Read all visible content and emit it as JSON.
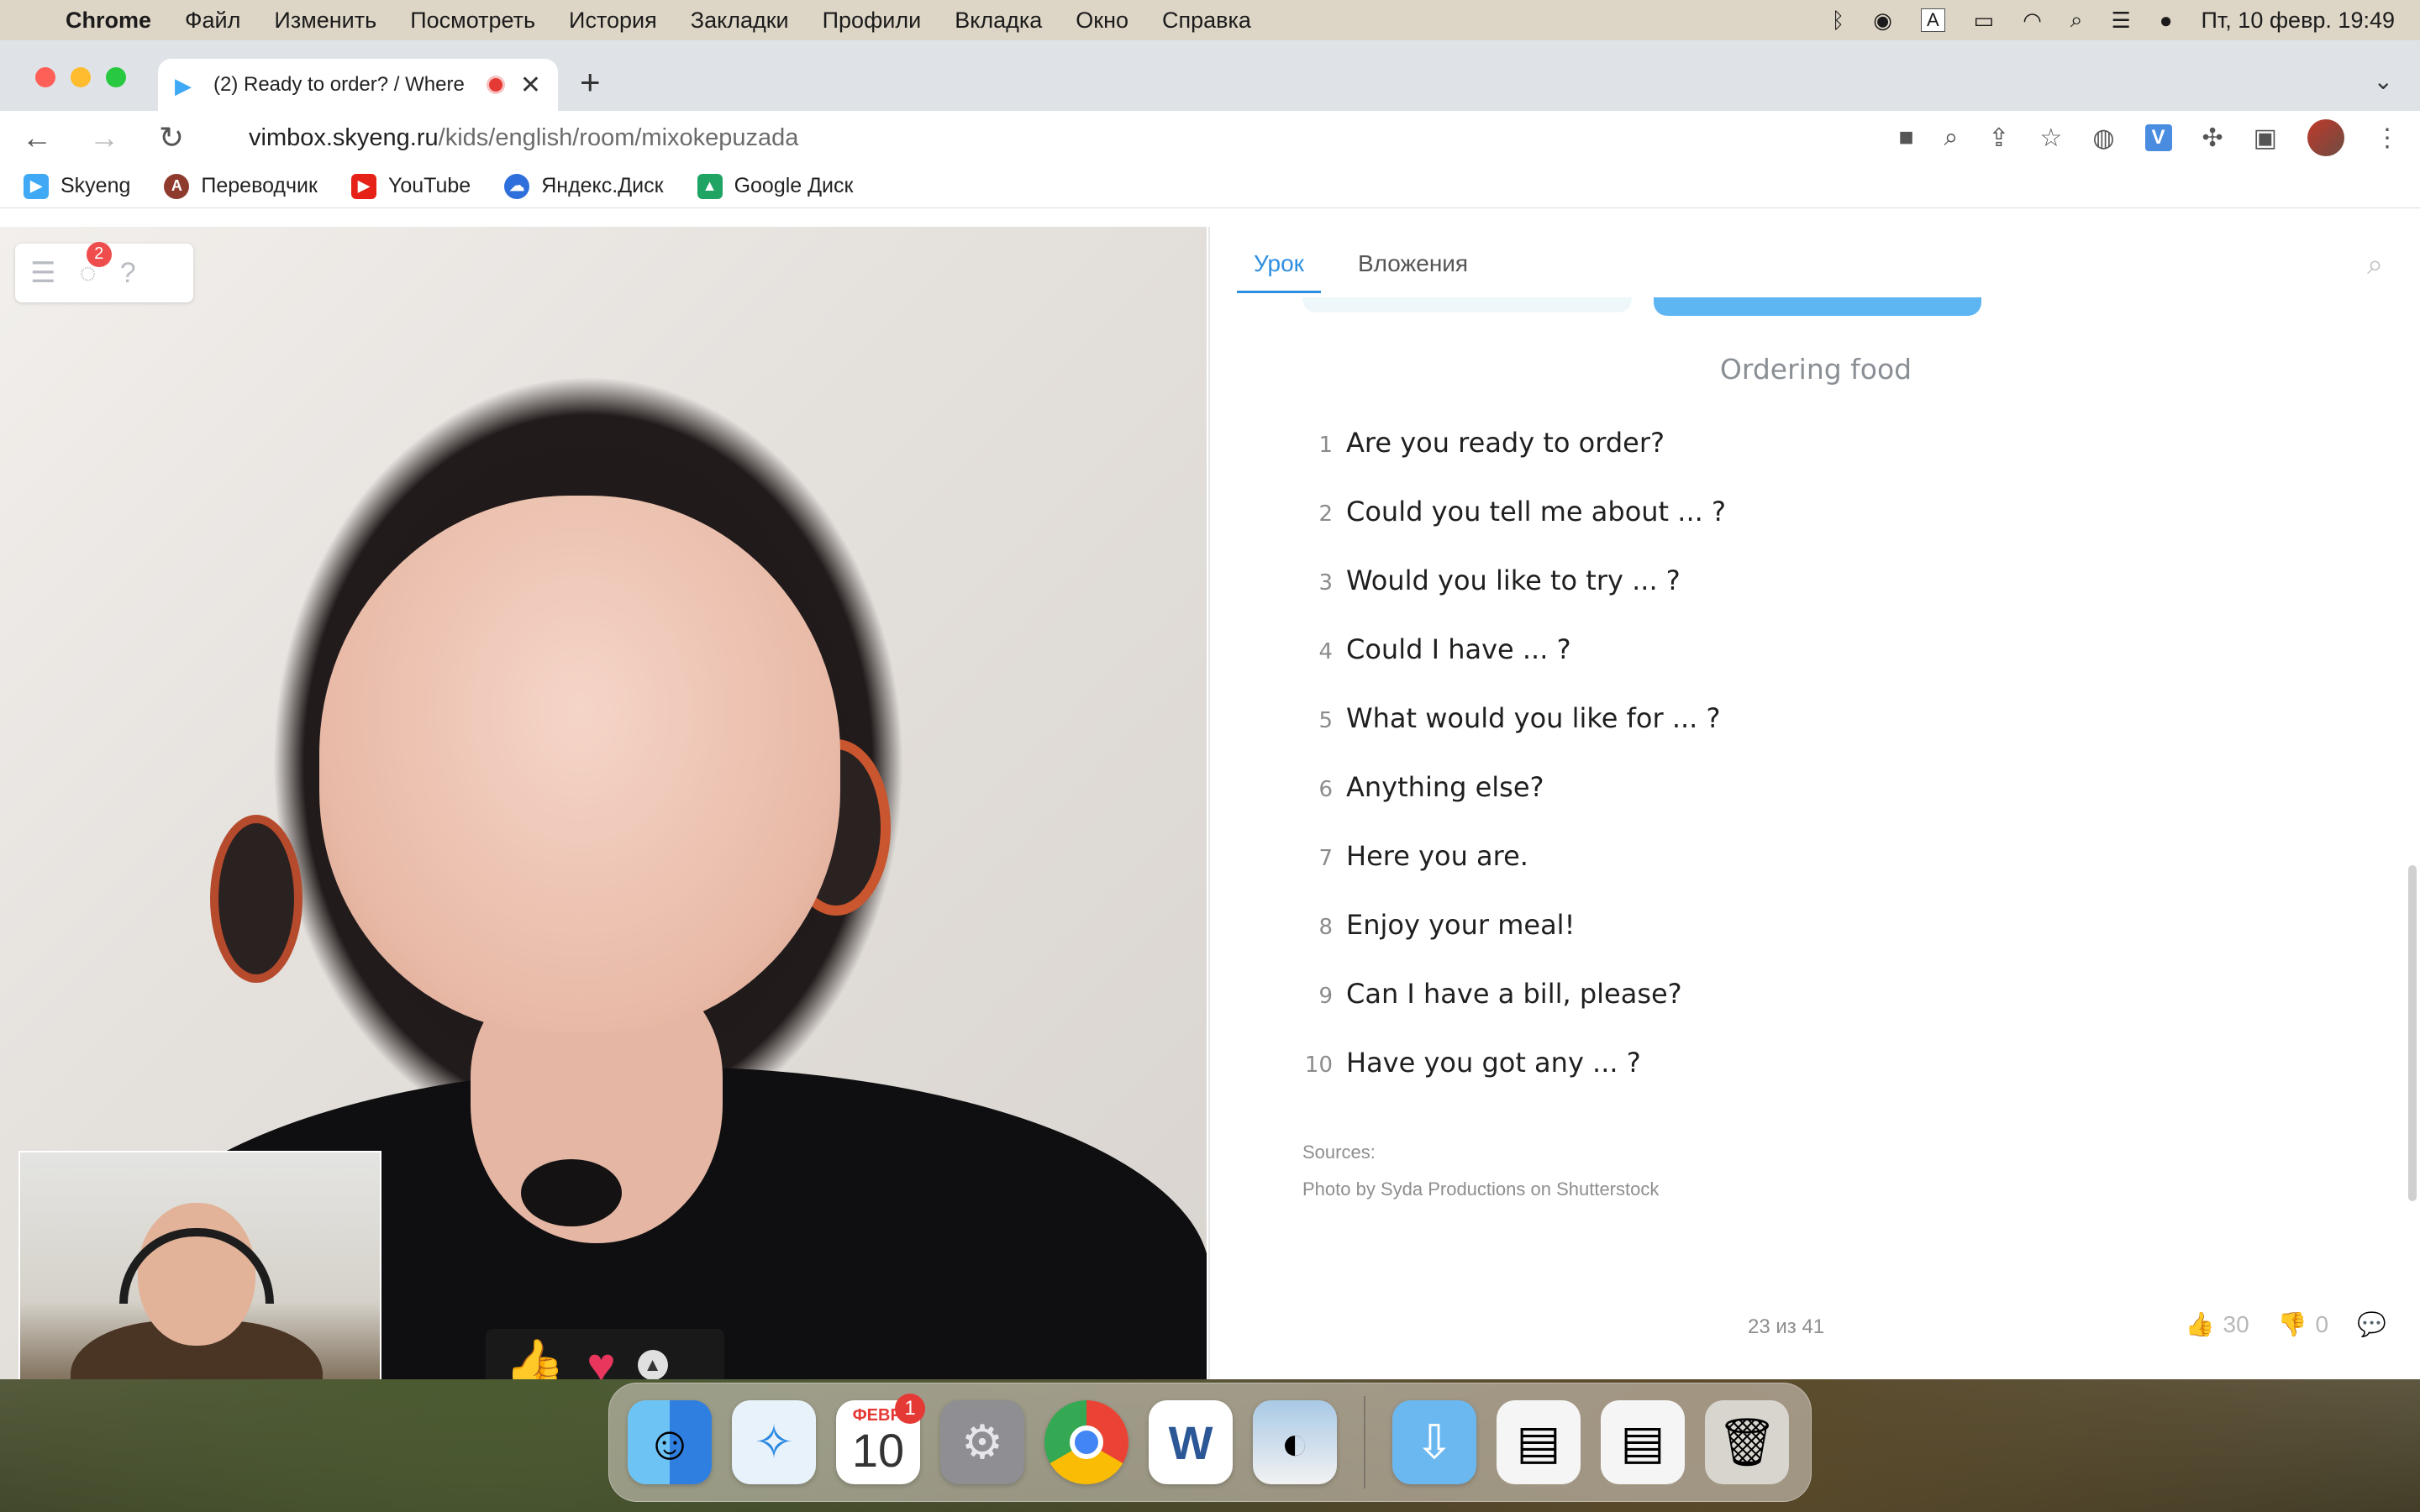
{
  "menubar": {
    "app": "Chrome",
    "items": [
      "Файл",
      "Изменить",
      "Посмотреть",
      "История",
      "Закладки",
      "Профили",
      "Вкладка",
      "Окно",
      "Справка"
    ],
    "input_source": "A",
    "clock": "Пт, 10 февр.  19:49"
  },
  "browser": {
    "tab_title": "(2) Ready to order? / Where",
    "url_host": "vimbox.skyeng.ru",
    "url_path": "/kids/english/room/mixokepuzada",
    "extension_label": "V",
    "bookmarks": [
      {
        "label": "Skyeng",
        "icon": "skyeng-icon",
        "color": "#3fa9f5"
      },
      {
        "label": "Переводчик",
        "icon": "translator-icon",
        "color": "#8e3b2e"
      },
      {
        "label": "YouTube",
        "icon": "youtube-icon",
        "color": "#e62117"
      },
      {
        "label": "Яндекс.Диск",
        "icon": "yandex-disk-icon",
        "color": "#2f6fdb"
      },
      {
        "label": "Google Диск",
        "icon": "google-drive-icon",
        "color": "#1fa463"
      }
    ]
  },
  "video": {
    "chat_badge": "2"
  },
  "lesson": {
    "tabs": [
      "Урок",
      "Вложения"
    ],
    "title": "Ordering food",
    "phrases": [
      {
        "num": "1",
        "text": "Are you ready to order?"
      },
      {
        "num": "2",
        "text": "Could you tell me about ... ?"
      },
      {
        "num": "3",
        "text": "Would you like to try ... ?"
      },
      {
        "num": "4",
        "text": "Could I have ... ?"
      },
      {
        "num": "5",
        "text": "What would you like for ... ?"
      },
      {
        "num": "6",
        "text": "Anything else?"
      },
      {
        "num": "7",
        "text": "Here you are."
      },
      {
        "num": "8",
        "text": "Enjoy your meal!"
      },
      {
        "num": "9",
        "text": "Can I have a bill, please?"
      },
      {
        "num": "10",
        "text": "Have you got any ... ?"
      }
    ],
    "sources_label": "Sources:",
    "sources_text": "Photo by Syda Productions on Shutterstock",
    "pager": "23 из 41",
    "likes": "30",
    "dislikes": "0"
  },
  "dock": {
    "calendar_month": "ФЕВР.",
    "calendar_day": "10",
    "calendar_badge": "1"
  },
  "colors": {
    "accent": "#2e8fe0",
    "badge": "#ef4d4d"
  }
}
